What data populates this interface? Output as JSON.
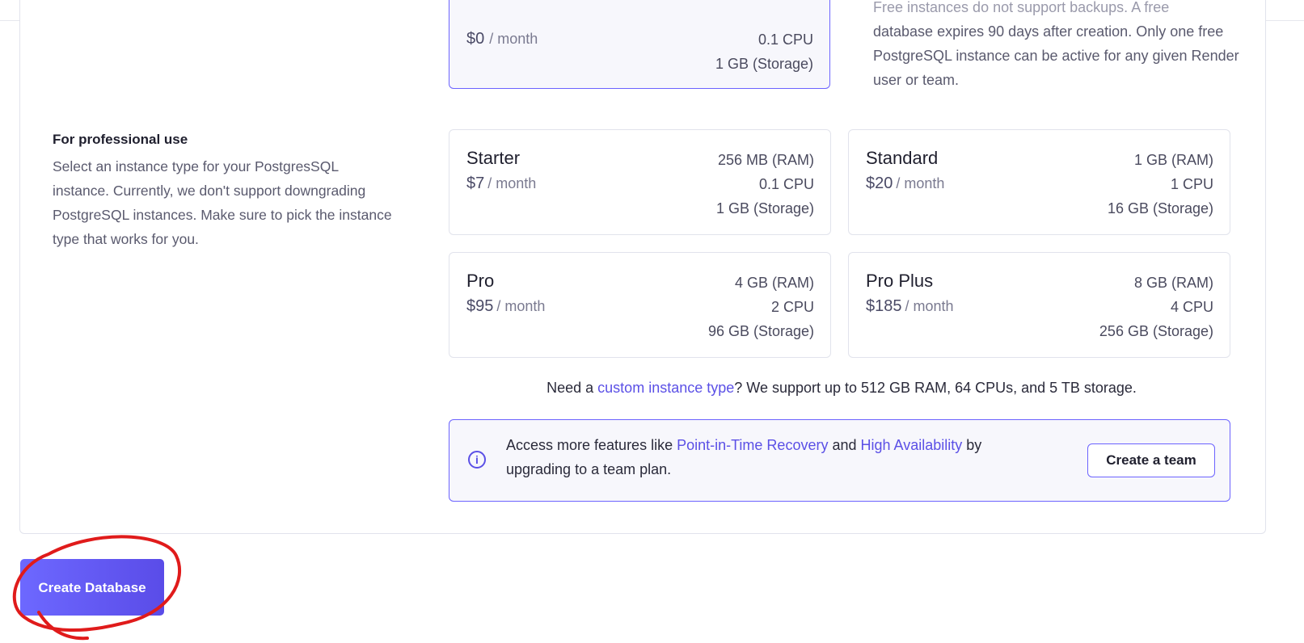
{
  "free_plan": {
    "price": "$0",
    "per": "/ month",
    "specs": [
      "0.1 CPU",
      "1 GB (Storage)"
    ],
    "note_faded": "Free instances do not support backups. A free",
    "note": "database expires 90 days after creation. Only one free PostgreSQL instance can be active for any given Render user or team."
  },
  "professional": {
    "title": "For professional use",
    "description": "Select an instance type for your PostgresSQL instance. Currently, we don't support downgrading PostgreSQL instances. Make sure to pick the instance type that works for you."
  },
  "plans": [
    {
      "name": "Starter",
      "price": "$7",
      "per": "/ month",
      "ram": "256 MB (RAM)",
      "cpu": "0.1 CPU",
      "storage": "1 GB (Storage)"
    },
    {
      "name": "Standard",
      "price": "$20",
      "per": "/ month",
      "ram": "1 GB (RAM)",
      "cpu": "1 CPU",
      "storage": "16 GB (Storage)"
    },
    {
      "name": "Pro",
      "price": "$95",
      "per": "/ month",
      "ram": "4 GB (RAM)",
      "cpu": "2 CPU",
      "storage": "96 GB (Storage)"
    },
    {
      "name": "Pro Plus",
      "price": "$185",
      "per": "/ month",
      "ram": "8 GB (RAM)",
      "cpu": "4 CPU",
      "storage": "256 GB (Storage)"
    }
  ],
  "custom": {
    "prefix": "Need a ",
    "link": "custom instance type",
    "suffix": "? We support up to 512 GB RAM, 64 CPUs, and 5 TB storage."
  },
  "team_info": {
    "icon": "info-icon",
    "text_1": "Access more features like ",
    "link_1": "Point-in-Time Recovery",
    "text_2": " and ",
    "link_2": "High Availability",
    "text_3": " by upgrading to a team plan.",
    "button": "Create a team"
  },
  "create_button": "Create Database",
  "colors": {
    "accent": "#6c63ff",
    "link": "#5b50e6",
    "annotation": "#e01b1b"
  }
}
